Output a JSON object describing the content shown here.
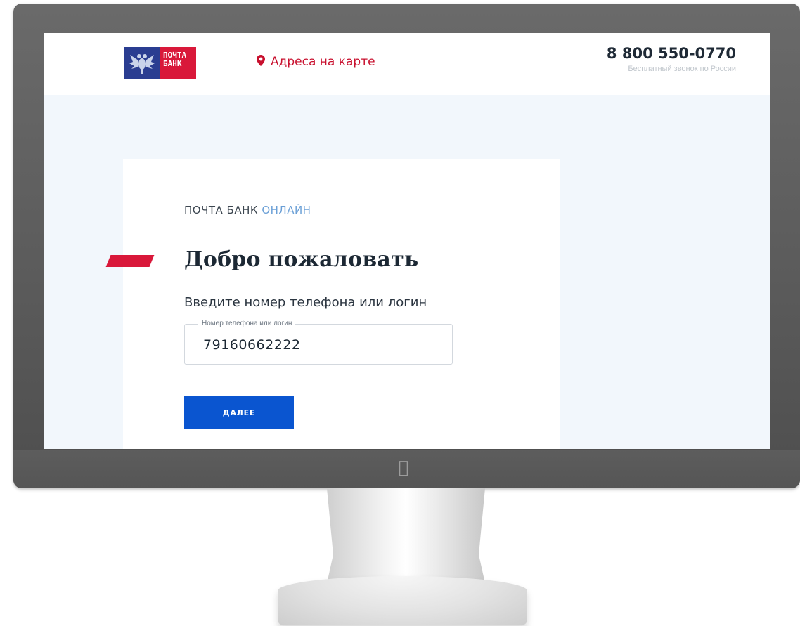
{
  "header": {
    "logo_text_line1": "ПОЧТА",
    "logo_text_line2": "БАНК",
    "map_link": "Адреса на карте",
    "phone_number": "8 800 550-0770",
    "phone_note": "Бесплатный звонок по России"
  },
  "card": {
    "brand_main": "ПОЧТА БАНК",
    "brand_accent": "ОНЛАЙН",
    "title": "Добро пожаловать",
    "subtitle": "Введите номер телефона или логин",
    "field_label": "Номер телефона или логин",
    "field_value": "79160662222",
    "next_button": "ДАЛЕЕ"
  },
  "colors": {
    "brand_blue": "#2a3d91",
    "brand_red": "#d9183a",
    "button_blue": "#0a55d0",
    "accent_blue": "#6a9fd6",
    "background": "#f2f7fc"
  },
  "icons": {
    "logo": "double-headed-eagle-icon",
    "map": "location-pin-icon",
    "device": "apple-logo-icon"
  }
}
